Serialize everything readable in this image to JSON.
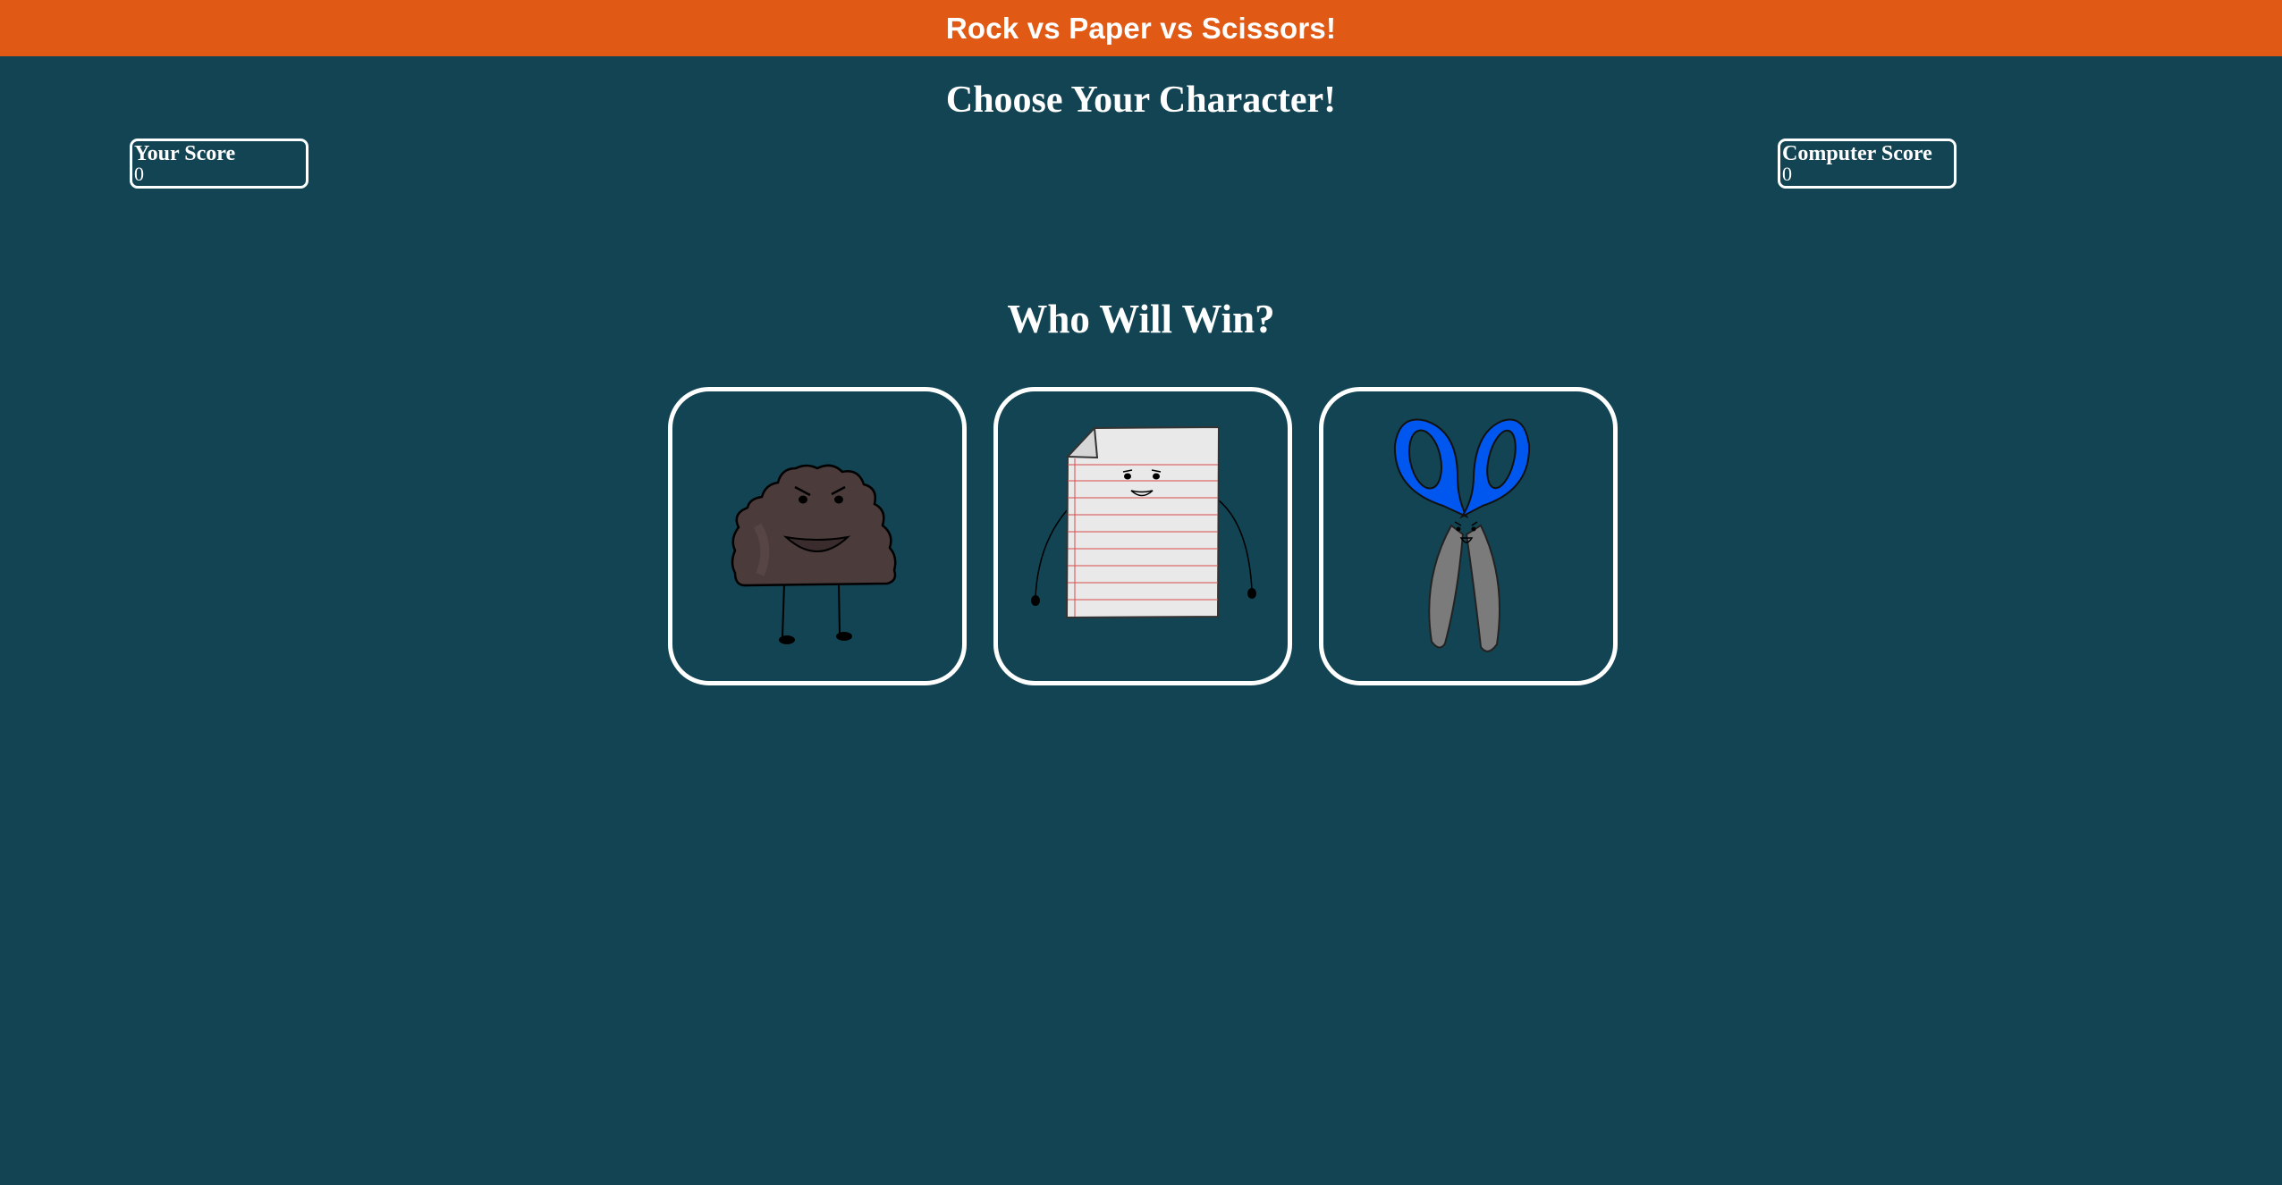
{
  "header": {
    "title": "Rock vs Paper vs Scissors!"
  },
  "main": {
    "subtitle": "Choose Your Character!",
    "question": "Who Will Win?"
  },
  "scores": {
    "player": {
      "label": "Your Score",
      "value": "0"
    },
    "computer": {
      "label": "Computer Score",
      "value": "0"
    }
  },
  "choices": [
    {
      "name": "rock",
      "icon": "rock-character-icon"
    },
    {
      "name": "paper",
      "icon": "paper-character-icon"
    },
    {
      "name": "scissors",
      "icon": "scissors-character-icon"
    }
  ],
  "colors": {
    "header_background": "#e05915",
    "page_background": "#134453",
    "border": "#ffffff",
    "rock": "#4b3b3b",
    "paper": "#e9e9e9",
    "paper_lines": "#d94a4a",
    "scissors_handles": "#0057f0",
    "scissors_blades": "#7b7b7b"
  }
}
